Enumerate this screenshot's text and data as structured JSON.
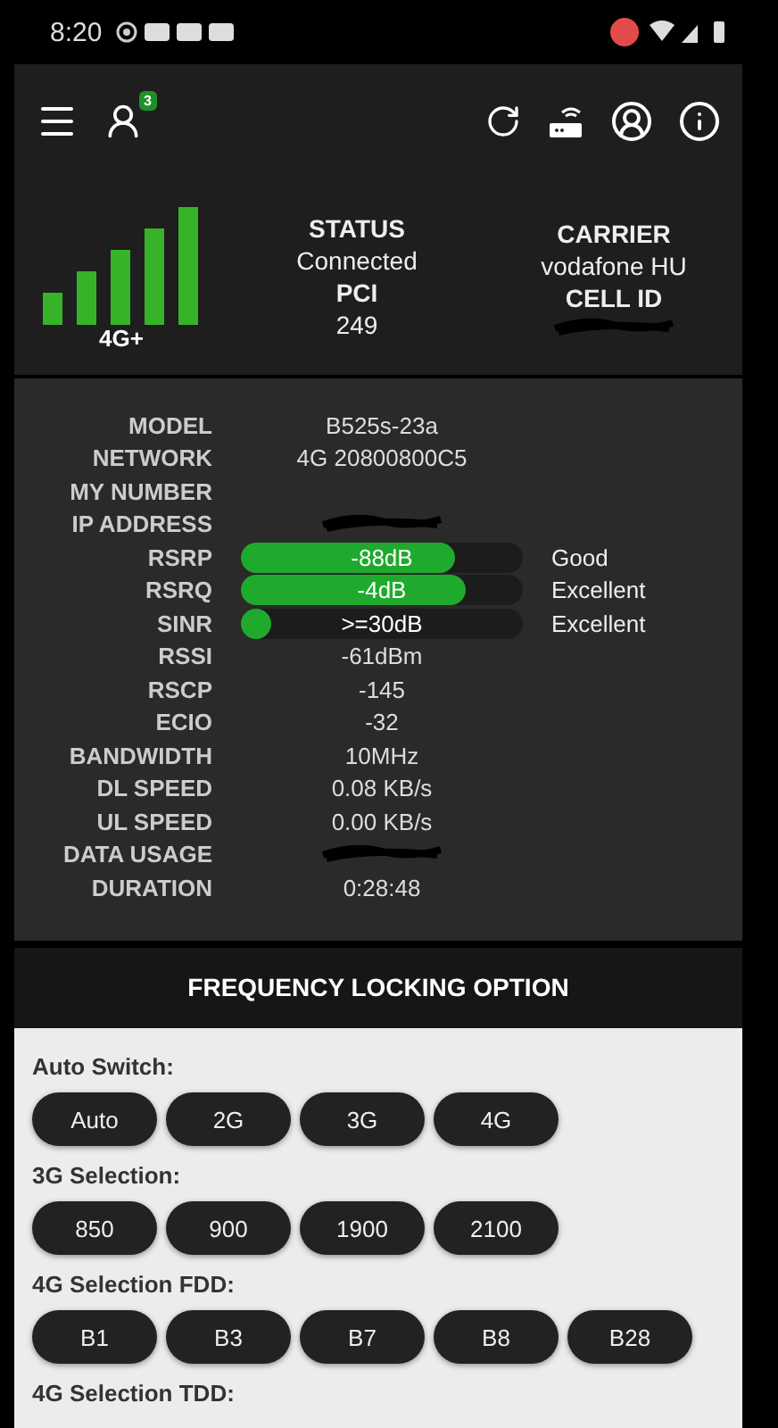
{
  "status_bar": {
    "time": "8:20"
  },
  "toolbar": {
    "badge": "3"
  },
  "summary": {
    "network_type": "4G+",
    "status_label": "STATUS",
    "status": "Connected",
    "pci_label": "PCI",
    "pci": "249",
    "carrier_label": "CARRIER",
    "carrier": "vodafone HU",
    "cell_id_label": "CELL ID"
  },
  "details": [
    {
      "kind": "text",
      "label": "MODEL",
      "value": "B525s-23a"
    },
    {
      "kind": "text",
      "label": "NETWORK",
      "value": "4G 20800800C5"
    },
    {
      "kind": "text",
      "label": "MY NUMBER"
    },
    {
      "kind": "hidden",
      "label": "IP ADDRESS"
    },
    {
      "kind": "meter",
      "label": "RSRP",
      "value": "-88dB",
      "level": 0.76,
      "quality": "Good"
    },
    {
      "kind": "meter",
      "label": "RSRQ",
      "value": "-4dB",
      "level": 0.8,
      "quality": "Excellent"
    },
    {
      "kind": "meter",
      "label": "SINR",
      "value": ">=30dB",
      "level": 0.1,
      "quality": "Excellent"
    },
    {
      "kind": "text",
      "label": "RSSI",
      "value": "-61dBm"
    },
    {
      "kind": "text",
      "label": "RSCP",
      "value": "-145"
    },
    {
      "kind": "text",
      "label": "ECIO",
      "value": "-32"
    },
    {
      "kind": "text",
      "label": "BANDWIDTH",
      "value": "10MHz"
    },
    {
      "kind": "text",
      "label": "DL SPEED",
      "value": "0.08 KB/s"
    },
    {
      "kind": "text",
      "label": "UL SPEED",
      "value": "0.00 KB/s"
    },
    {
      "kind": "hidden",
      "label": "DATA USAGE"
    },
    {
      "kind": "text",
      "label": "DURATION",
      "value": "0:28:48"
    }
  ],
  "frequency_locking": {
    "title": "FREQUENCY LOCKING OPTION",
    "groups": [
      {
        "label": "Auto Switch:",
        "options": [
          "Auto",
          "2G",
          "3G",
          "4G"
        ]
      },
      {
        "label": "3G Selection:",
        "options": [
          "850",
          "900",
          "1900",
          "2100"
        ]
      },
      {
        "label": "4G Selection FDD:",
        "options": [
          "B1",
          "B3",
          "B7",
          "B8",
          "B28"
        ]
      },
      {
        "label": "4G Selection TDD:"
      }
    ]
  }
}
